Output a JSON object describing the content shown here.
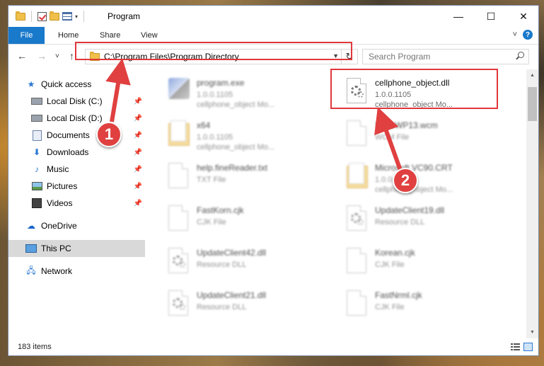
{
  "window": {
    "title": "Program",
    "controls": {
      "minimize": "—",
      "maximize": "☐",
      "close": "✕"
    }
  },
  "ribbon": {
    "file": "File",
    "tabs": [
      "Home",
      "Share",
      "View"
    ],
    "expand": "˅",
    "help": "?"
  },
  "nav": {
    "back": "←",
    "forward": "→",
    "recent": "˅",
    "up": "↑",
    "address": "C:\\Program Files\\Program Directory",
    "search_placeholder": "Search Program"
  },
  "sidebar": {
    "items": [
      {
        "label": "Quick access",
        "icon": "star-icon",
        "pinned": false
      },
      {
        "label": "Local Disk (C:)",
        "icon": "drive-icon",
        "pinned": true
      },
      {
        "label": "Local Disk (D:)",
        "icon": "drive-icon",
        "pinned": true
      },
      {
        "label": "Documents",
        "icon": "documents-icon",
        "pinned": true
      },
      {
        "label": "Downloads",
        "icon": "downloads-icon",
        "pinned": true
      },
      {
        "label": "Music",
        "icon": "music-icon",
        "pinned": true
      },
      {
        "label": "Pictures",
        "icon": "pictures-icon",
        "pinned": true
      },
      {
        "label": "Videos",
        "icon": "videos-icon",
        "pinned": true
      },
      {
        "label": "OneDrive",
        "icon": "cloud-icon",
        "pinned": false
      },
      {
        "label": "This PC",
        "icon": "computer-icon",
        "pinned": false
      },
      {
        "label": "Network",
        "icon": "network-icon",
        "pinned": false
      }
    ]
  },
  "files": [
    {
      "name": "program.exe",
      "line1": "1.0.0.1105",
      "line2": "cellphone_object Mo...",
      "kind": "exe"
    },
    {
      "name": "cellphone_object.dll",
      "line1": "1.0.0.1105",
      "line2": "cellphone_object Mo...",
      "kind": "dll"
    },
    {
      "name": "x64",
      "line1": "1.0.0.1105",
      "line2": "cellphone_object Mo...",
      "kind": "folder"
    },
    {
      "name": "StatoWP13.wcm",
      "line1": "WCM File",
      "line2": "",
      "kind": "page"
    },
    {
      "name": "help.fineReader.txt",
      "line1": "TXT File",
      "line2": "",
      "kind": "page"
    },
    {
      "name": "Microsoft.VC90.CRT",
      "line1": "1.0.0.1105",
      "line2": "cellphone_object Mo...",
      "kind": "folder"
    },
    {
      "name": "FastKorn.cjk",
      "line1": "CJK File",
      "line2": "",
      "kind": "page"
    },
    {
      "name": "UpdateClient19.dll",
      "line1": "Resource DLL",
      "line2": "",
      "kind": "dll"
    },
    {
      "name": "UpdateClient42.dll",
      "line1": "Resource DLL",
      "line2": "",
      "kind": "dll"
    },
    {
      "name": "Korean.cjk",
      "line1": "CJK File",
      "line2": "",
      "kind": "page"
    },
    {
      "name": "UpdateClient21.dll",
      "line1": "Resource DLL",
      "line2": "",
      "kind": "dll"
    },
    {
      "name": "FastNrml.cjk",
      "line1": "CJK File",
      "line2": "",
      "kind": "page"
    }
  ],
  "status": {
    "count": "183 items"
  },
  "callouts": {
    "one": "1",
    "two": "2"
  },
  "colors": {
    "accent": "#1979ca",
    "highlight": "#e0373b",
    "selected": "#d9d9d9"
  }
}
